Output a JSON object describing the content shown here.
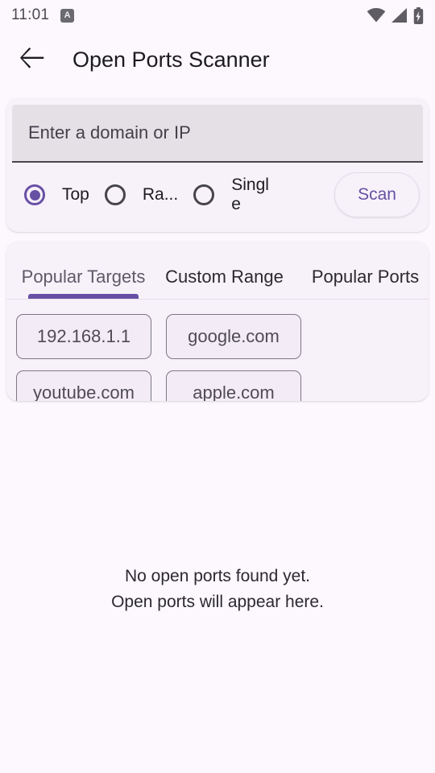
{
  "status_bar": {
    "time": "11:01",
    "notification_icon_letter": "A",
    "icons": [
      "wifi-icon",
      "cellular-signal-icon",
      "battery-charging-icon"
    ]
  },
  "app_bar": {
    "back_icon": "back-arrow-icon",
    "title": "Open Ports Scanner"
  },
  "scan_form": {
    "input": {
      "value": "",
      "placeholder": "Enter a domain or IP"
    },
    "modes": [
      {
        "label": "Top",
        "selected": true
      },
      {
        "label": "Ra...",
        "selected": false
      },
      {
        "label": "Single",
        "selected": false
      }
    ],
    "scan_button_label": "Scan"
  },
  "tabs": [
    {
      "label": "Popular Targets",
      "active": true
    },
    {
      "label": "Custom Range",
      "active": false
    },
    {
      "label": "Popular Ports",
      "active": false
    }
  ],
  "chips": [
    {
      "label": "192.168.1.1"
    },
    {
      "label": "google.com"
    },
    {
      "label": "youtube.com"
    },
    {
      "label": "apple.com"
    }
  ],
  "empty_state": {
    "line1": "No open ports found yet.",
    "line2": "Open ports will appear here."
  },
  "colors": {
    "background": "#fdf7fe",
    "card": "#f7f1f9",
    "accent": "#6750a4",
    "field_fill": "#e5e0e6",
    "text": "#1c1b1f"
  }
}
